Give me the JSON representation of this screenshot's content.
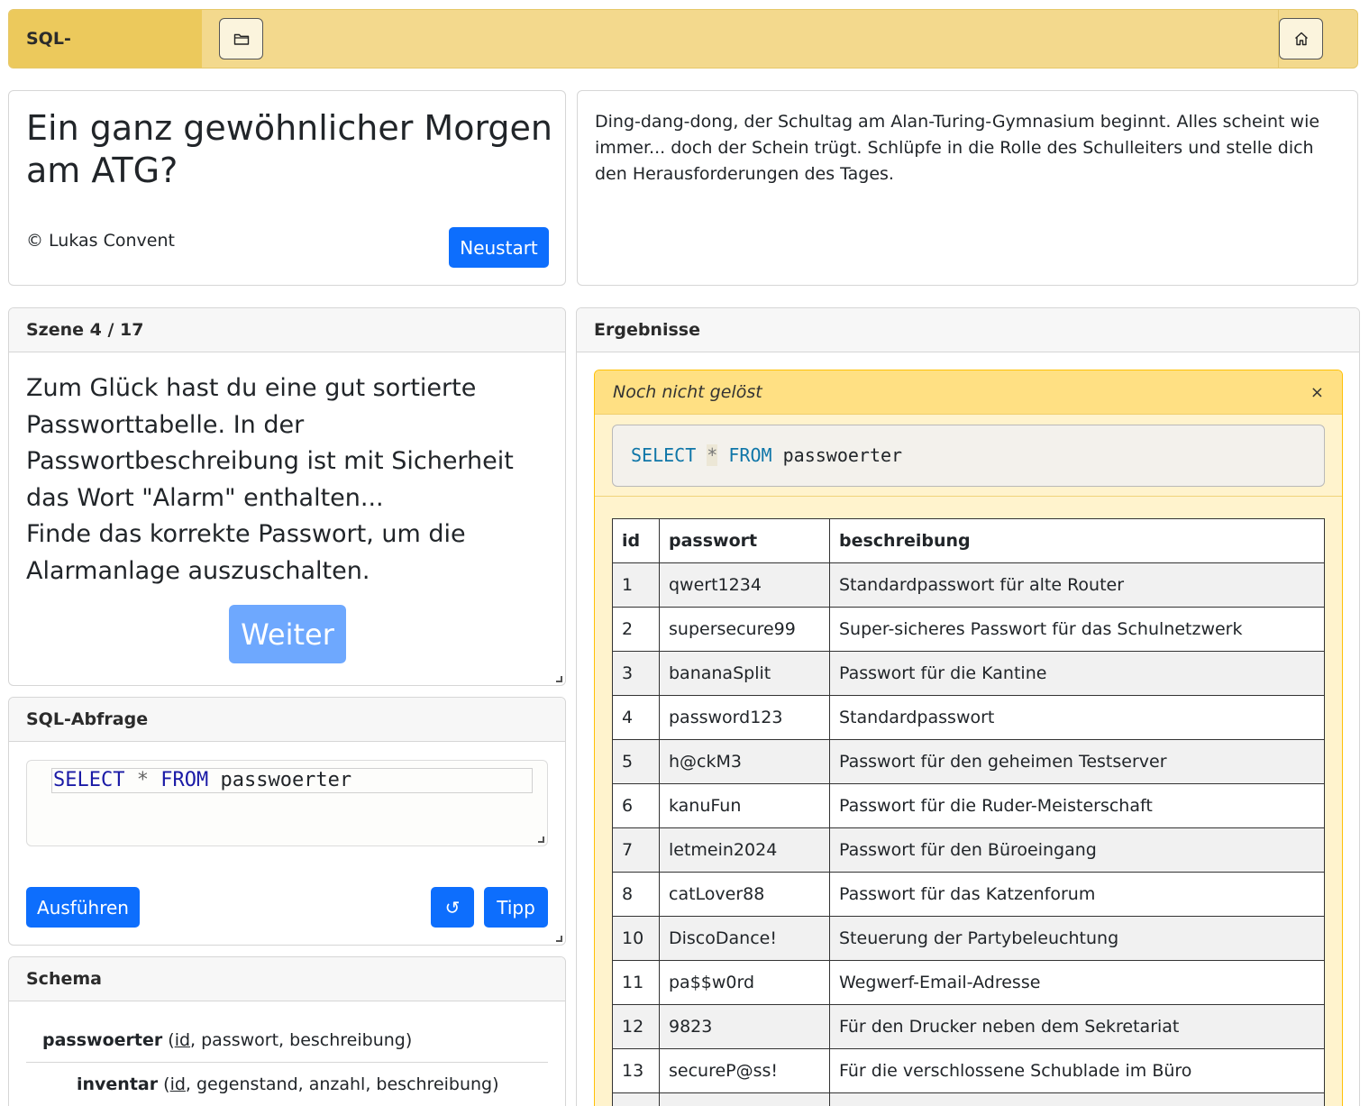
{
  "navbar": {
    "brand": "SQL-Spielekonsole",
    "folder_icon": "folder-icon",
    "home_icon": "home-icon"
  },
  "game": {
    "title": "Ein ganz gewöhnlicher Morgen am ATG?",
    "copyright": "© Lukas Convent",
    "restart_label": "Neustart",
    "intro": "Ding-dang-dong, der Schultag am Alan-Turing-Gymnasium beginnt. Alles scheint wie immer... doch der Schein trügt. Schlüpfe in die Rolle des Schulleiters und stelle dich den Herausforderungen des Tages."
  },
  "scene": {
    "header": "Szene 4 / 17",
    "text_line1": "Zum Glück hast du eine gut sortierte Passworttabelle. In der Passwortbeschreibung ist mit Sicherheit das Wort \"Alarm\" enthalten...",
    "text_line2": "Finde das korrekte Passwort, um die Alarmanlage auszuschalten.",
    "next_label": "Weiter"
  },
  "sql": {
    "header": "SQL-Abfrage",
    "query_select": "SELECT",
    "query_star": "*",
    "query_from": "FROM",
    "query_table": "passwoerter",
    "execute_label": "Ausführen",
    "reset_label": "↺",
    "hint_label": "Tipp"
  },
  "schema": {
    "header": "Schema",
    "tables": [
      {
        "name": "passwoerter",
        "key": "id",
        "rest": ", passwort, beschreibung)"
      },
      {
        "name": "inventar",
        "key": "id",
        "rest": ", gegenstand, anzahl, beschreibung)"
      }
    ]
  },
  "results": {
    "header": "Ergebnisse",
    "status": "Noch nicht gelöst",
    "close_label": "×",
    "query_select": "SELECT",
    "query_star": "*",
    "query_from": "FROM",
    "query_table": "passwoerter",
    "columns": [
      "id",
      "passwort",
      "beschreibung"
    ],
    "rows": [
      [
        "1",
        "qwert1234",
        "Standardpasswort für alte Router"
      ],
      [
        "2",
        "supersecure99",
        "Super-sicheres Passwort für das Schulnetzwerk"
      ],
      [
        "3",
        "bananaSplit",
        "Passwort für die Kantine"
      ],
      [
        "4",
        "password123",
        "Standardpasswort"
      ],
      [
        "5",
        "h@ckM3",
        "Passwort für den geheimen Testserver"
      ],
      [
        "6",
        "kanuFun",
        "Passwort für die Ruder-Meisterschaft"
      ],
      [
        "7",
        "letmein2024",
        "Passwort für den Büroeingang"
      ],
      [
        "8",
        "catLover88",
        "Passwort für das Katzenforum"
      ],
      [
        "10",
        "DiscoDance!",
        "Steuerung der Partybeleuchtung"
      ],
      [
        "11",
        "pa$$w0rd",
        "Wegwerf-Email-Adresse"
      ],
      [
        "12",
        "9823",
        "Für den Drucker neben dem Sekretariat"
      ],
      [
        "13",
        "secureP@ss!",
        "Für die verschlossene Schublade im Büro"
      ],
      [
        "",
        "",
        ""
      ]
    ]
  }
}
